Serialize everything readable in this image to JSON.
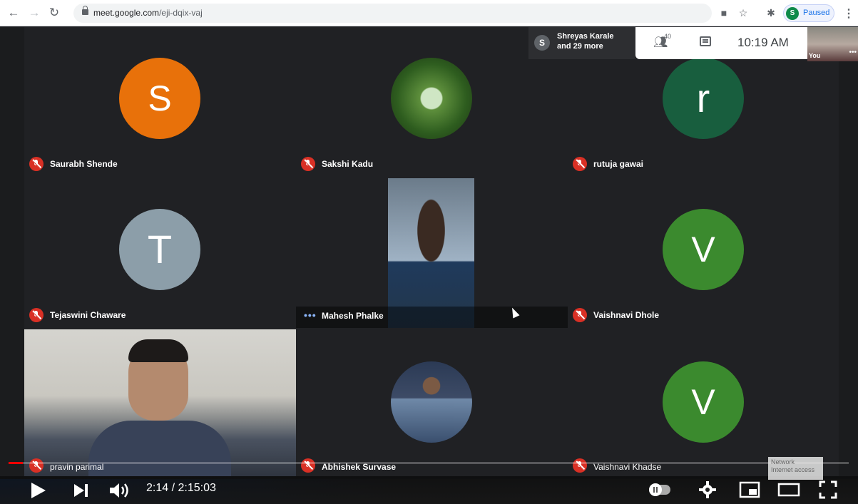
{
  "browser": {
    "url_host": "meet.google.com",
    "url_path": "/eji-dqix-vaj",
    "profile_initial": "S",
    "profile_status": "Paused"
  },
  "meet": {
    "presenter": {
      "initial": "S",
      "line1": "Shreyas Karale",
      "line2": "and 29 more"
    },
    "participant_count": "40",
    "clock": "10:19 AM",
    "self_label": "You",
    "tiles": [
      {
        "name": "Saurabh Shende",
        "initial": "S",
        "color": "#e8710a"
      },
      {
        "name": "Sakshi Kadu",
        "initial": "",
        "color": "#2e5d1f"
      },
      {
        "name": "rutuja gawai",
        "initial": "r",
        "color": "#185e3e"
      },
      {
        "name": "Tejaswini Chaware",
        "initial": "T",
        "color": "#8c9ea9"
      },
      {
        "name": "Mahesh Phalke",
        "initial": "",
        "color": "#4a5568"
      },
      {
        "name": "Vaishnavi Dhole",
        "initial": "V",
        "color": "#3b8a2e"
      },
      {
        "name": "pravin parimal",
        "initial": "",
        "color": "#6f7580"
      },
      {
        "name": "Abhishek Survase",
        "initial": "",
        "color": "#2b3a55"
      },
      {
        "name": "Vaishnavi Khadse",
        "initial": "V",
        "color": "#3b8a2e"
      }
    ]
  },
  "player": {
    "time": "2:14 / 2:15:03",
    "progress": 0.017,
    "network_tip_line1": "Network",
    "network_tip_line2": "Internet access"
  }
}
